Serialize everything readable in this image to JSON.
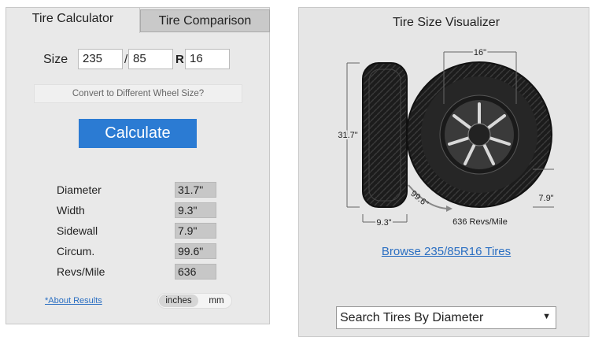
{
  "tabs": {
    "calculator": "Tire Calculator",
    "comparison": "Tire Comparison"
  },
  "size": {
    "label": "Size",
    "width": "235",
    "slash": "/",
    "ratio": "85",
    "r": "R",
    "rim": "16"
  },
  "convert_label": "Convert to Different Wheel Size?",
  "calculate_label": "Calculate",
  "results": [
    {
      "label": "Diameter",
      "value": "31.7\""
    },
    {
      "label": "Width",
      "value": "9.3\""
    },
    {
      "label": "Sidewall",
      "value": "7.9\""
    },
    {
      "label": "Circum.",
      "value": "99.6\""
    },
    {
      "label": "Revs/Mile",
      "value": "636"
    }
  ],
  "about_label": "*About Results",
  "units": {
    "inches": "inches",
    "mm": "mm"
  },
  "visualizer": {
    "title": "Tire Size Visualizer",
    "rim_dim": "16\"",
    "diameter_dim": "31.7\"",
    "width_dim": "9.3\"",
    "sidewall_dim": "7.9\"",
    "circum_dim": "99.6\"",
    "revs": "636 Revs/Mile"
  },
  "browse_label": "Browse 235/85R16 Tires",
  "search_select": "Search Tires By Diameter",
  "colors": {
    "accent": "#2b7bd3",
    "link": "#2b6fc2"
  }
}
